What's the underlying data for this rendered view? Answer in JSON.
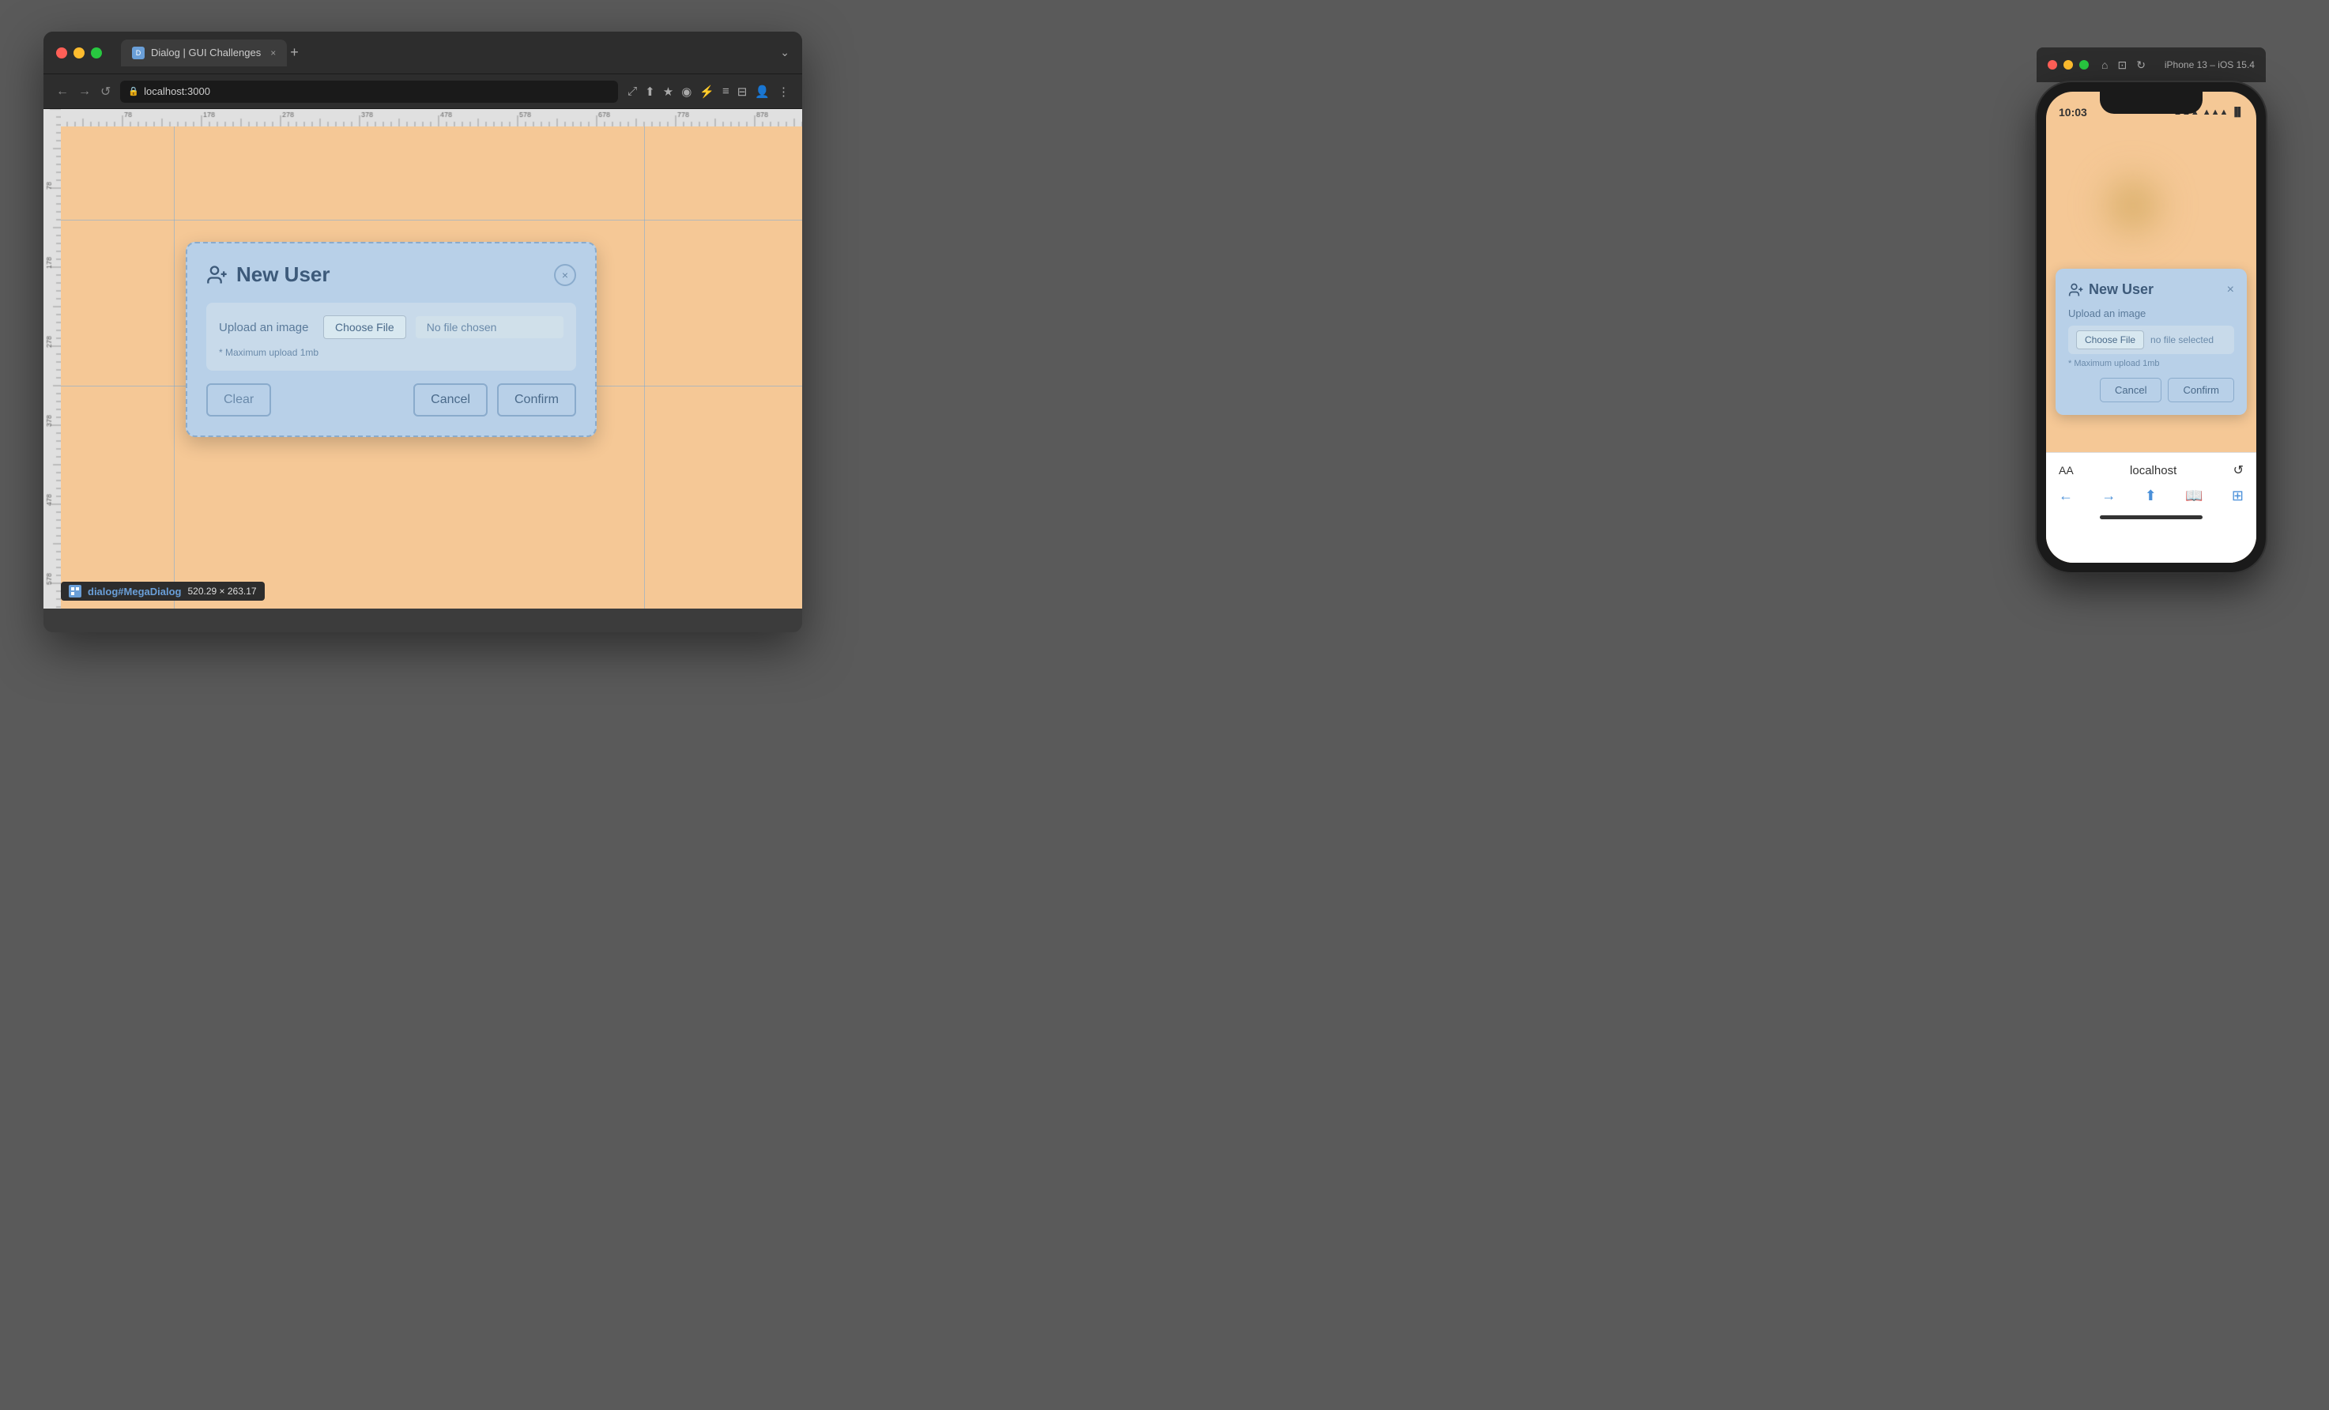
{
  "browser": {
    "traffic_lights": [
      "red",
      "yellow",
      "green"
    ],
    "tab_title": "Dialog | GUI Challenges",
    "tab_close": "×",
    "tab_add": "+",
    "expand_icon": "⌄",
    "url": "localhost:3000",
    "nav": {
      "back": "←",
      "forward": "→",
      "refresh": "↺"
    },
    "toolbar_icons": [
      "⤢",
      "⬆",
      "★",
      "◉",
      "⚡",
      "≡",
      "⊟",
      "👤",
      "⋮"
    ]
  },
  "dialog": {
    "title": "New User",
    "close_label": "×",
    "upload_label": "Upload an image",
    "choose_file_label": "Choose File",
    "no_file_label": "No file chosen",
    "max_upload_text": "* Maximum upload 1mb",
    "btn_clear": "Clear",
    "btn_cancel": "Cancel",
    "btn_confirm": "Confirm"
  },
  "dimension_badge": {
    "selector": "dialog#MegaDialog",
    "dimensions": "520.29 × 263.17"
  },
  "iphone": {
    "title": "iPhone 13 – iOS 15.4",
    "traffic_lights": [
      "red",
      "yellow",
      "green"
    ],
    "time": "10:03",
    "status_icons": "… ▲ ■",
    "dialog": {
      "title": "New User",
      "close_label": "×",
      "upload_label": "Upload an image",
      "choose_file_label": "Choose File",
      "no_file_label": "no file selected",
      "max_upload_text": "* Maximum upload 1mb",
      "btn_cancel": "Cancel",
      "btn_confirm": "Confirm"
    },
    "bottom": {
      "aa_label": "AA",
      "url": "localhost",
      "refresh_icon": "↺"
    }
  }
}
